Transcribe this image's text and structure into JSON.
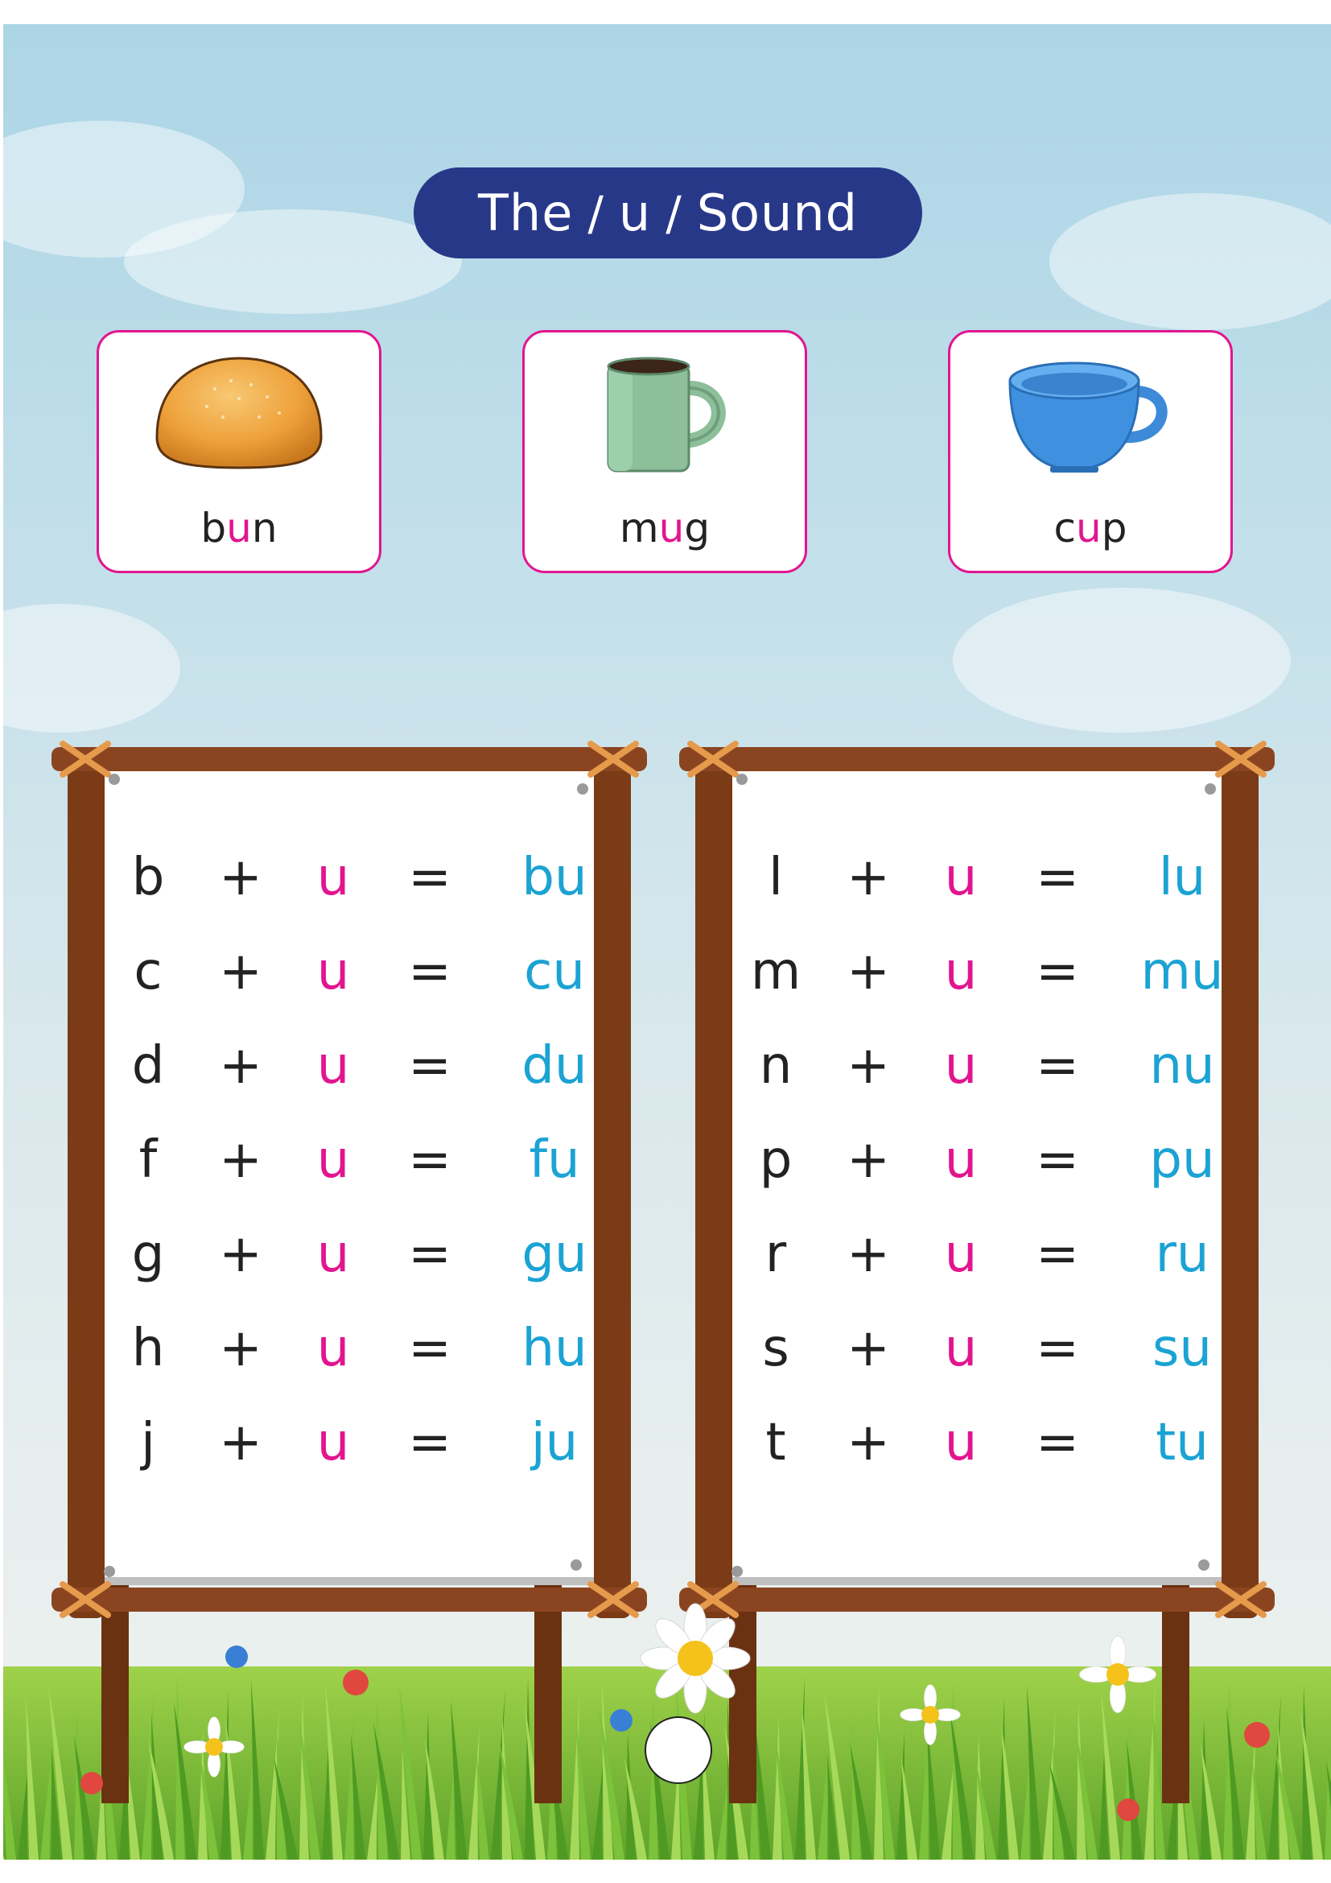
{
  "title": {
    "prefix": "The",
    "slash1": "/",
    "letter": "u",
    "slash2": "/",
    "suffix": "Sound"
  },
  "pictures": [
    {
      "icon": "bun-icon",
      "pre": "b",
      "hl": "u",
      "post": "n"
    },
    {
      "icon": "mug-icon",
      "pre": "m",
      "hl": "u",
      "post": "g"
    },
    {
      "icon": "cup-icon",
      "pre": "c",
      "hl": "u",
      "post": "p"
    }
  ],
  "operators": {
    "plus": "+",
    "equals": "=",
    "vowel": "u"
  },
  "boards": [
    {
      "rows": [
        {
          "consonant": "b",
          "result": "bu"
        },
        {
          "consonant": "c",
          "result": "cu"
        },
        {
          "consonant": "d",
          "result": "du"
        },
        {
          "consonant": "f",
          "result": "fu"
        },
        {
          "consonant": "g",
          "result": "gu"
        },
        {
          "consonant": "h",
          "result": "hu"
        },
        {
          "consonant": "j",
          "result": "ju"
        }
      ]
    },
    {
      "rows": [
        {
          "consonant": "l",
          "result": "lu"
        },
        {
          "consonant": "m",
          "result": "mu"
        },
        {
          "consonant": "n",
          "result": "nu"
        },
        {
          "consonant": "p",
          "result": "pu"
        },
        {
          "consonant": "r",
          "result": "ru"
        },
        {
          "consonant": "s",
          "result": "su"
        },
        {
          "consonant": "t",
          "result": "tu"
        }
      ]
    }
  ],
  "colors": {
    "title_bg": "#283889",
    "highlight": "#e2158f",
    "result": "#1ba3d3",
    "wood": "#7a3b16"
  }
}
